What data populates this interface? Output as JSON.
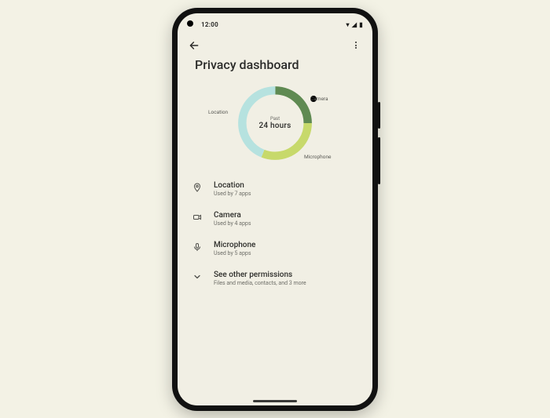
{
  "status": {
    "time": "12:00"
  },
  "title": "Privacy dashboard",
  "chart_data": {
    "type": "pie",
    "title": "Past 24 hours",
    "categories": [
      "Camera",
      "Microphone",
      "Location"
    ],
    "values": [
      25,
      31,
      44
    ],
    "colors": {
      "Camera": "#5f8a52",
      "Microphone": "#c7d96b",
      "Location": "#b6e2df"
    }
  },
  "chart": {
    "center_small": "Past",
    "center_big": "24 hours",
    "labels": {
      "camera": "Camera",
      "microphone": "Microphone",
      "location": "Location"
    }
  },
  "rows": {
    "location": {
      "title": "Location",
      "sub": "Used by 7 apps"
    },
    "camera": {
      "title": "Camera",
      "sub": "Used by 4 apps"
    },
    "microphone": {
      "title": "Microphone",
      "sub": "Used by 5 apps"
    },
    "other": {
      "title": "See other permissions",
      "sub": "Files and media, contacts, and 3 more"
    }
  }
}
